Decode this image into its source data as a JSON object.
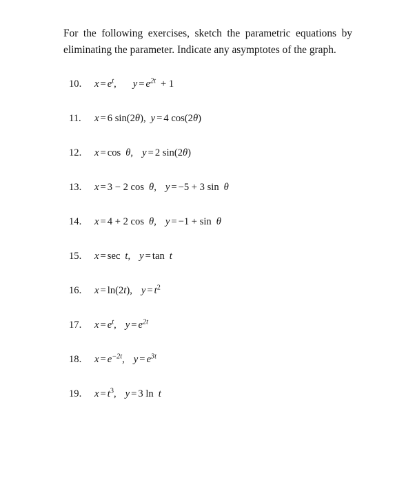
{
  "document": {
    "type": "textbook-exercise-page",
    "background_color": "#ffffff",
    "text_color": "#141414"
  },
  "intro": {
    "text": "For the following exercises, sketch the parametric equations by eliminating the parameter. Indicate any asymptotes of the graph."
  },
  "exercises": [
    {
      "number": "10.",
      "x_expression": "x = e^t,",
      "y_expression": "y = e^{2t} + 1",
      "plain": "x = e^t,  y = e^2t + 1"
    },
    {
      "number": "11.",
      "x_expression": "x = 6 sin(2θ),",
      "y_expression": "y = 4 cos(2θ)",
      "plain": "x = 6 sin(2θ), y = 4 cos(2θ)"
    },
    {
      "number": "12.",
      "x_expression": "x = cos θ,",
      "y_expression": "y = 2 sin(2θ)",
      "plain": "x = cos θ,  y = 2 sin(2θ)"
    },
    {
      "number": "13.",
      "x_expression": "x = 3 − 2 cos θ,",
      "y_expression": "y = −5 + 3 sin θ",
      "plain": "x = 3 − 2 cos θ,  y = −5 + 3 sin θ"
    },
    {
      "number": "14.",
      "x_expression": "x = 4 + 2 cos θ,",
      "y_expression": "y = −1 + sin θ",
      "plain": "x = 4 + 2 cos θ,  y = −1 + sin θ"
    },
    {
      "number": "15.",
      "x_expression": "x = sec t,",
      "y_expression": "y = tan t",
      "plain": "x = sec t,  y = tan t"
    },
    {
      "number": "16.",
      "x_expression": "x = ln(2t),",
      "y_expression": "y = t^2",
      "plain": "x = ln(2t),  y = t^2"
    },
    {
      "number": "17.",
      "x_expression": "x = e^t,",
      "y_expression": "y = e^{2t}",
      "plain": "x = e^t,  y = e^2t"
    },
    {
      "number": "18.",
      "x_expression": "x = e^{−2t},",
      "y_expression": "y = e^{3t}",
      "plain": "x = e^−2t,  y = e^3t"
    },
    {
      "number": "19.",
      "x_expression": "x = t^3,",
      "y_expression": "y = 3 ln t",
      "plain": "x = t^3,  y = 3 ln t"
    }
  ],
  "math_parts": {
    "ex10": {
      "x_var": "x",
      "x_eq": "=",
      "x_base": "e",
      "x_sup": "t",
      "x_tail": ",",
      "y_var": "y",
      "y_eq": "=",
      "y_base": "e",
      "y_sup": "2t",
      "y_tail": "+ 1"
    },
    "ex11": {
      "x_var": "x",
      "x_eq": "=",
      "x_body": "6 sin(2",
      "x_theta": "θ",
      "x_tail": "),",
      "y_var": "y",
      "y_eq": "=",
      "y_body": "4 cos(2",
      "y_theta": "θ",
      "y_tail": ")"
    },
    "ex12": {
      "x_var": "x",
      "x_eq": "=",
      "x_body": "cos",
      "x_theta": "θ",
      "x_tail": ",",
      "y_var": "y",
      "y_eq": "=",
      "y_body": "2 sin(2",
      "y_theta": "θ",
      "y_tail": ")"
    },
    "ex13": {
      "x_var": "x",
      "x_eq": "=",
      "x_body": "3 − 2 cos",
      "x_theta": "θ",
      "x_tail": ",",
      "y_var": "y",
      "y_eq": "=",
      "y_body": "−5 + 3 sin",
      "y_theta": "θ",
      "y_tail": ""
    },
    "ex14": {
      "x_var": "x",
      "x_eq": "=",
      "x_body": "4 + 2 cos",
      "x_theta": "θ",
      "x_tail": ",",
      "y_var": "y",
      "y_eq": "=",
      "y_body": "−1 + sin",
      "y_theta": "θ",
      "y_tail": ""
    },
    "ex15": {
      "x_var": "x",
      "x_eq": "=",
      "x_fn": "sec",
      "x_arg": "t",
      "x_tail": ",",
      "y_var": "y",
      "y_eq": "=",
      "y_fn": "tan",
      "y_arg": "t",
      "y_tail": ""
    },
    "ex16": {
      "x_var": "x",
      "x_eq": "=",
      "x_fn": "ln(2",
      "x_arg": "t",
      "x_tail": "),",
      "y_var": "y",
      "y_eq": "=",
      "y_base": "t",
      "y_sup": "2"
    },
    "ex17": {
      "x_var": "x",
      "x_eq": "=",
      "x_base": "e",
      "x_sup": "t",
      "x_tail": ",",
      "y_var": "y",
      "y_eq": "=",
      "y_base": "e",
      "y_sup": "2t"
    },
    "ex18": {
      "x_var": "x",
      "x_eq": "=",
      "x_base": "e",
      "x_sup": "−2t",
      "x_tail": ",",
      "y_var": "y",
      "y_eq": "=",
      "y_base": "e",
      "y_sup": "3t"
    },
    "ex19": {
      "x_var": "x",
      "x_eq": "=",
      "x_base": "t",
      "x_sup": "3",
      "x_tail": ",",
      "y_var": "y",
      "y_eq": "=",
      "y_body": "3 ln",
      "y_arg": "t"
    }
  }
}
